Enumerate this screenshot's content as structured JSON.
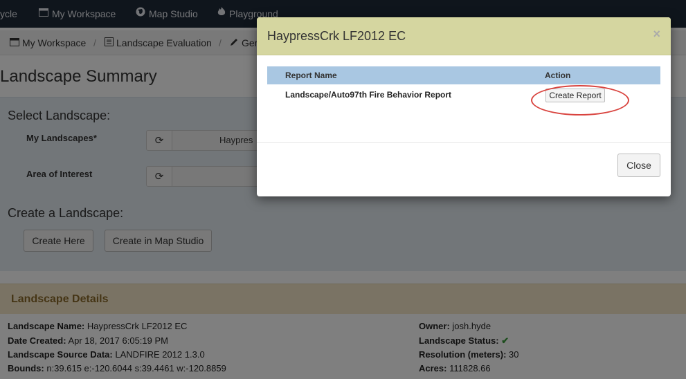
{
  "topnav": {
    "items": [
      {
        "label": "ycle",
        "icon": ""
      },
      {
        "label": "My Workspace",
        "icon": "window-icon"
      },
      {
        "label": "Map Studio",
        "icon": "globe-icon"
      },
      {
        "label": "Playground",
        "icon": "fire-icon"
      }
    ]
  },
  "breadcrumb": {
    "items": [
      {
        "label": "My Workspace",
        "icon": "window-icon"
      },
      {
        "label": "Landscape Evaluation",
        "icon": "list-icon"
      },
      {
        "label": "Ger",
        "icon": "pencil-icon"
      }
    ]
  },
  "page": {
    "title": "Landscape Summary"
  },
  "select_landscape": {
    "heading": "Select Landscape:",
    "my_landscapes_label": "My Landscapes*",
    "my_landscapes_value": "Haypres",
    "area_of_interest_label": "Area of Interest",
    "area_of_interest_value": ""
  },
  "create_landscape": {
    "heading": "Create a Landscape:",
    "create_here": "Create Here",
    "create_in_map_studio": "Create in Map Studio"
  },
  "details": {
    "title": "Landscape Details",
    "rows_left": [
      {
        "label": "Landscape Name:",
        "value": "HaypressCrk LF2012 EC"
      },
      {
        "label": "Date Created:",
        "value": "Apr 18, 2017 6:05:19 PM"
      },
      {
        "label": "Landscape Source Data:",
        "value": "LANDFIRE 2012 1.3.0"
      },
      {
        "label": "Bounds:",
        "value": "n:39.615 e:-120.6044 s:39.4461 w:-120.8859"
      }
    ],
    "rows_right": [
      {
        "label": "Owner:",
        "value": "josh.hyde"
      },
      {
        "label": "Landscape Status:",
        "value": "✔"
      },
      {
        "label": "Resolution (meters):",
        "value": "30"
      },
      {
        "label": "Acres:",
        "value": "111828.66"
      }
    ]
  },
  "modal": {
    "title": "HaypressCrk LF2012 EC",
    "close_x": "×",
    "col_report_name": "Report Name",
    "col_action": "Action",
    "report_name": "Landscape/Auto97th Fire Behavior Report",
    "create_report": "Create Report",
    "close_button": "Close"
  },
  "colors": {
    "nav_bg": "#1f2a38",
    "modal_header_bg": "#d5d6a0",
    "table_header_bg": "#a9c7e2",
    "highlight": "#d9443f",
    "status_ok": "#3a9a3a"
  }
}
